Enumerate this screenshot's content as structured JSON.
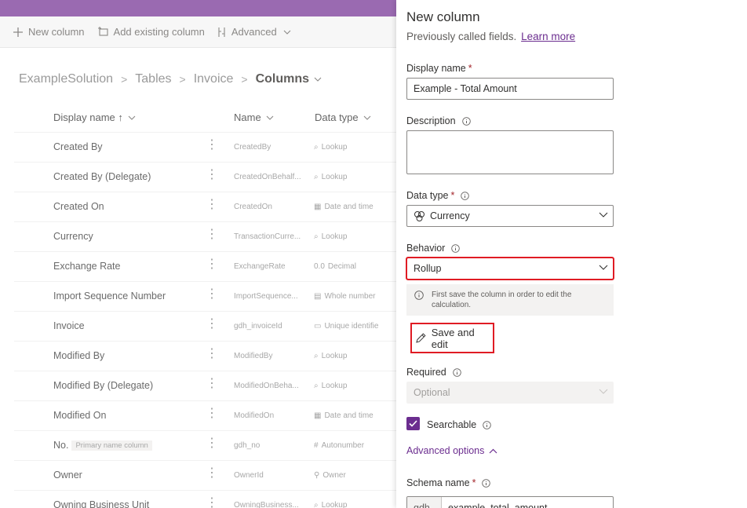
{
  "commandbar": {
    "new_column": "New column",
    "add_existing_column": "Add existing column",
    "advanced": "Advanced"
  },
  "breadcrumb": {
    "solution": "ExampleSolution",
    "tables": "Tables",
    "table": "Invoice",
    "current": "Columns"
  },
  "list": {
    "headers": {
      "display_name": "Display name ↑",
      "name": "Name",
      "data_type": "Data type"
    },
    "rows": [
      {
        "display": "Created By",
        "name": "CreatedBy",
        "type_icon": "⌕",
        "type": "Lookup"
      },
      {
        "display": "Created By (Delegate)",
        "name": "CreatedOnBehalf...",
        "type_icon": "⌕",
        "type": "Lookup"
      },
      {
        "display": "Created On",
        "name": "CreatedOn",
        "type_icon": "▦",
        "type": "Date and time"
      },
      {
        "display": "Currency",
        "name": "TransactionCurre...",
        "type_icon": "⌕",
        "type": "Lookup"
      },
      {
        "display": "Exchange Rate",
        "name": "ExchangeRate",
        "type_icon": "0.0",
        "type": "Decimal"
      },
      {
        "display": "Import Sequence Number",
        "name": "ImportSequence...",
        "type_icon": "▤",
        "type": "Whole number"
      },
      {
        "display": "Invoice",
        "name": "gdh_invoiceId",
        "type_icon": "▭",
        "type": "Unique identifie"
      },
      {
        "display": "Modified By",
        "name": "ModifiedBy",
        "type_icon": "⌕",
        "type": "Lookup"
      },
      {
        "display": "Modified By (Delegate)",
        "name": "ModifiedOnBeha...",
        "type_icon": "⌕",
        "type": "Lookup"
      },
      {
        "display": "Modified On",
        "name": "ModifiedOn",
        "type_icon": "▦",
        "type": "Date and time"
      },
      {
        "display": "No.",
        "tag": "Primary name column",
        "name": "gdh_no",
        "type_icon": "#",
        "type": "Autonumber"
      },
      {
        "display": "Owner",
        "name": "OwnerId",
        "type_icon": "⚲",
        "type": "Owner"
      },
      {
        "display": "Owning Business Unit",
        "name": "OwningBusiness...",
        "type_icon": "⌕",
        "type": "Lookup"
      }
    ]
  },
  "panel": {
    "title": "New column",
    "subtitle": "Previously called fields.",
    "learn_more": "Learn more",
    "display_name_label": "Display name",
    "display_name_value": "Example - Total Amount",
    "description_label": "Description",
    "data_type_label": "Data type",
    "data_type_value": "Currency",
    "behavior_label": "Behavior",
    "behavior_value": "Rollup",
    "notice": "First save the column in order to edit the calculation.",
    "save_and_edit": "Save and edit",
    "required_label": "Required",
    "required_value": "Optional",
    "searchable_label": "Searchable",
    "advanced_options": "Advanced options",
    "schema_name_label": "Schema name",
    "schema_prefix": "gdh",
    "schema_value": "example_total_amount",
    "required_marker": "*"
  },
  "colors": {
    "brand_purple": "#6b2d8f",
    "highlight_red": "#e01b24",
    "top_bar": "#9a6ab1"
  }
}
